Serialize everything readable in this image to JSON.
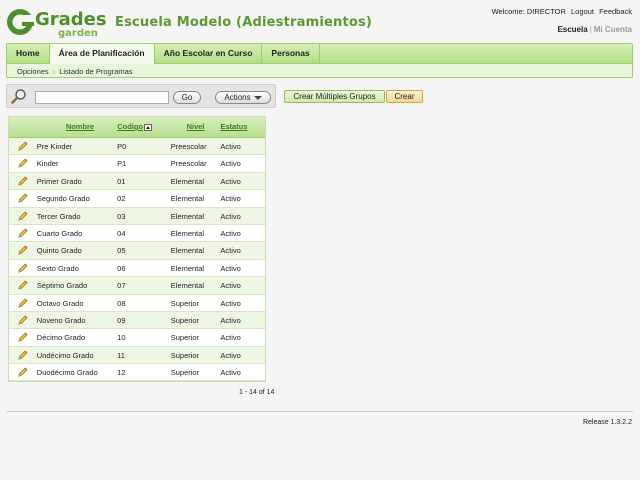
{
  "header": {
    "logo_text_top": "Grades",
    "logo_text_bottom": "garden",
    "title": "Escuela Modelo (Adiestramientos)",
    "welcome": "Welcome: DIRECTOR",
    "logout": "Logout",
    "feedback": "Feedback",
    "context_active": "Escuela",
    "context_separator": "|",
    "context_other": "Mi Cuenta"
  },
  "nav": {
    "tabs": [
      {
        "label": "Home",
        "active": false
      },
      {
        "label": "Área de Planificación",
        "active": true
      },
      {
        "label": "Año Escolar en Curso",
        "active": false
      },
      {
        "label": "Personas",
        "active": false
      }
    ],
    "breadcrumb": {
      "parent": "Opciones",
      "separator": "›",
      "current": "Listado de Programas"
    }
  },
  "toolbar": {
    "search_icon": "magnifier-icon",
    "search_value": "",
    "go_label": "Go",
    "actions_label": "Actions"
  },
  "buttons": {
    "crear_multiples": "Crear Múltiples Grupos",
    "crear": "Crear"
  },
  "table": {
    "columns": {
      "name": "Nombre",
      "code": "Codigo",
      "nivel": "Nivel",
      "status": "Estatus"
    },
    "sort_icon": "sort-ascending-icon",
    "edit_icon": "pencil-icon",
    "rows": [
      {
        "name": "Pre Kinder",
        "code": "P0",
        "nivel": "Preescolar",
        "status": "Activo"
      },
      {
        "name": "Kinder",
        "code": "P1",
        "nivel": "Preescolar",
        "status": "Activo"
      },
      {
        "name": "Primer Grado",
        "code": "01",
        "nivel": "Elemental",
        "status": "Activo"
      },
      {
        "name": "Segundo Grado",
        "code": "02",
        "nivel": "Elemental",
        "status": "Activo"
      },
      {
        "name": "Tercer Grado",
        "code": "03",
        "nivel": "Elemental",
        "status": "Activo"
      },
      {
        "name": "Cuarto Grado",
        "code": "04",
        "nivel": "Elemental",
        "status": "Activo"
      },
      {
        "name": "Quinto Grado",
        "code": "05",
        "nivel": "Elemental",
        "status": "Activo"
      },
      {
        "name": "Sexto Grado",
        "code": "06",
        "nivel": "Elemental",
        "status": "Activo"
      },
      {
        "name": "Séptimo Grado",
        "code": "07",
        "nivel": "Elemental",
        "status": "Activo"
      },
      {
        "name": "Octavo Grado",
        "code": "08",
        "nivel": "Superior",
        "status": "Activo"
      },
      {
        "name": "Noveno Grado",
        "code": "09",
        "nivel": "Superior",
        "status": "Activo"
      },
      {
        "name": "Décimo Grado",
        "code": "10",
        "nivel": "Superior",
        "status": "Activo"
      },
      {
        "name": "Undécimo Grado",
        "code": "11",
        "nivel": "Superior",
        "status": "Activo"
      },
      {
        "name": "Duodécimo Grado",
        "code": "12",
        "nivel": "Superior",
        "status": "Activo"
      }
    ],
    "pager": "1 - 14 of 14"
  },
  "footer": {
    "release": "Release 1.3.2.2"
  },
  "colors": {
    "brand_green": "#5b9a30",
    "accent_orange": "#f6d98f"
  }
}
